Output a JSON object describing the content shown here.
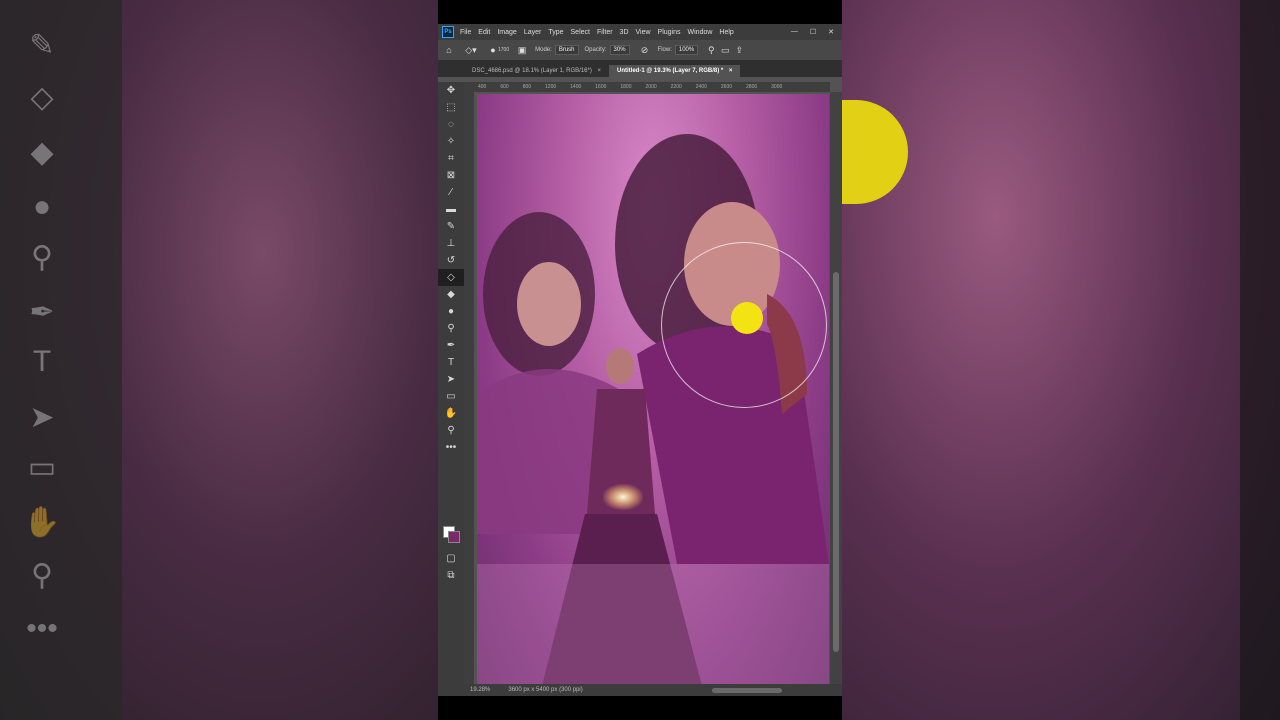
{
  "app": {
    "logo": "Ps",
    "menu": [
      "File",
      "Edit",
      "Image",
      "Layer",
      "Type",
      "Select",
      "Filter",
      "3D",
      "View",
      "Plugins",
      "Window",
      "Help"
    ],
    "window_controls": [
      "—",
      "☐",
      "✕"
    ]
  },
  "options": {
    "brush_size": "1700",
    "mode_label": "Mode:",
    "mode_value": "Brush",
    "opacity_label": "Opacity:",
    "opacity_value": "30%",
    "flow_label": "Flow:",
    "flow_value": "100%",
    "angle_value": "0°"
  },
  "tabs": [
    {
      "label": "DSC_4686.psd @ 18.1% (Layer 1, RGB/16*)",
      "close": "×"
    },
    {
      "label": "Untitled-1 @ 19.3% (Layer 7, RGB/8) *",
      "close": "×"
    }
  ],
  "ruler_ticks": [
    "400",
    "600",
    "800",
    "1200",
    "1400",
    "1600",
    "1800",
    "2000",
    "2200",
    "2400",
    "2600",
    "2800",
    "3000"
  ],
  "status": {
    "zoom": "19.28%",
    "doc_size": "3600 px x 5400 px (300 ppi)"
  },
  "icons": {
    "active_tool": "eraser-icon",
    "cursor_color": "#f3e312",
    "accent": "#31a8ff"
  }
}
